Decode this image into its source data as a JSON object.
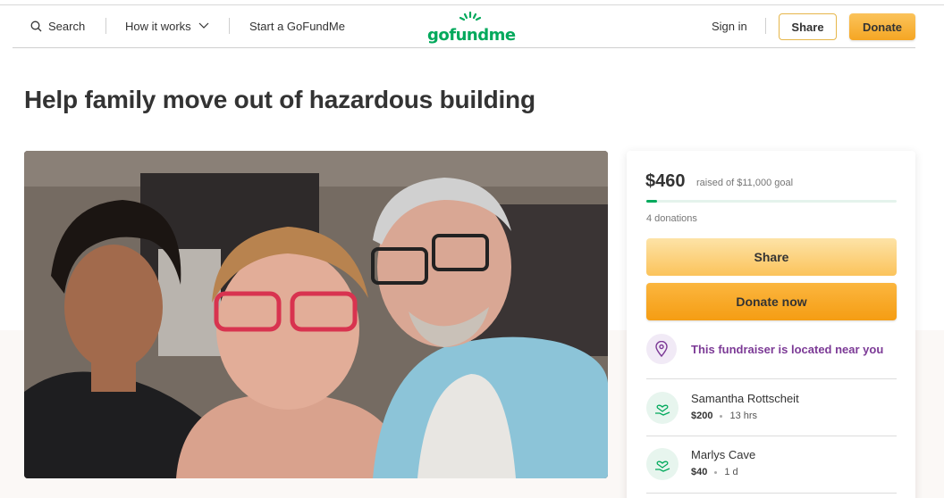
{
  "header": {
    "search_label": "Search",
    "how_it_works_label": "How it works",
    "start_label": "Start a GoFundMe",
    "logo_text": "gofundme",
    "sign_in_label": "Sign in",
    "share_label": "Share",
    "donate_label": "Donate"
  },
  "campaign": {
    "title": "Help family move out of hazardous building"
  },
  "donation_card": {
    "raised": "$460",
    "goal_text": "raised of $11,000 goal",
    "progress_fraction": 0.042,
    "donations_count": "4 donations",
    "share_button": "Share",
    "donate_button": "Donate now",
    "location_text": "This fundraiser is located near you",
    "donors": [
      {
        "name": "Samantha Rottscheit",
        "amount": "$200",
        "time": "13 hrs"
      },
      {
        "name": "Marlys Cave",
        "amount": "$40",
        "time": "1 d"
      }
    ]
  },
  "colors": {
    "brand_green": "#02a95c",
    "donate_orange": "#f5a623",
    "location_purple": "#7c3a96"
  }
}
